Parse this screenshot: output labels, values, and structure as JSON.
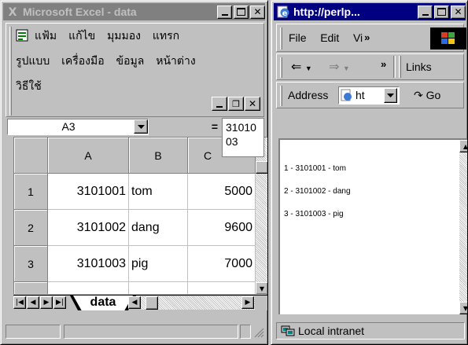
{
  "excel": {
    "title": "Microsoft Excel - data",
    "menu_line1": [
      "แฟ้ม",
      "แก้ไข",
      "มุมมอง",
      "แทรก"
    ],
    "menu_line2": [
      "รูปแบบ",
      "เครื่องมือ",
      "ข้อมูล",
      "หน้าต่าง"
    ],
    "menu_line3": [
      "วิธีใช้"
    ],
    "name_box": "A3",
    "formula_eq": "=",
    "formula_value": "3101003",
    "columns": [
      "A",
      "B",
      "C"
    ],
    "rows": [
      {
        "num": "1",
        "a": "3101001",
        "b": "tom",
        "c": "5000"
      },
      {
        "num": "2",
        "a": "3101002",
        "b": "dang",
        "c": "9600"
      },
      {
        "num": "3",
        "a": "3101003",
        "b": "pig",
        "c": "7000"
      }
    ],
    "sheet_tab": "data"
  },
  "ie": {
    "title": "http://perlp...",
    "menu": [
      "File",
      "Edit",
      "Vi"
    ],
    "links_label": "Links",
    "address_label": "Address",
    "address_value": "ht",
    "go_label": "Go",
    "lines": [
      "1 - 3101001 - tom",
      "2 - 3101002 - dang",
      "3 - 3101003 - pig"
    ],
    "status_zone": "Local intranet"
  }
}
